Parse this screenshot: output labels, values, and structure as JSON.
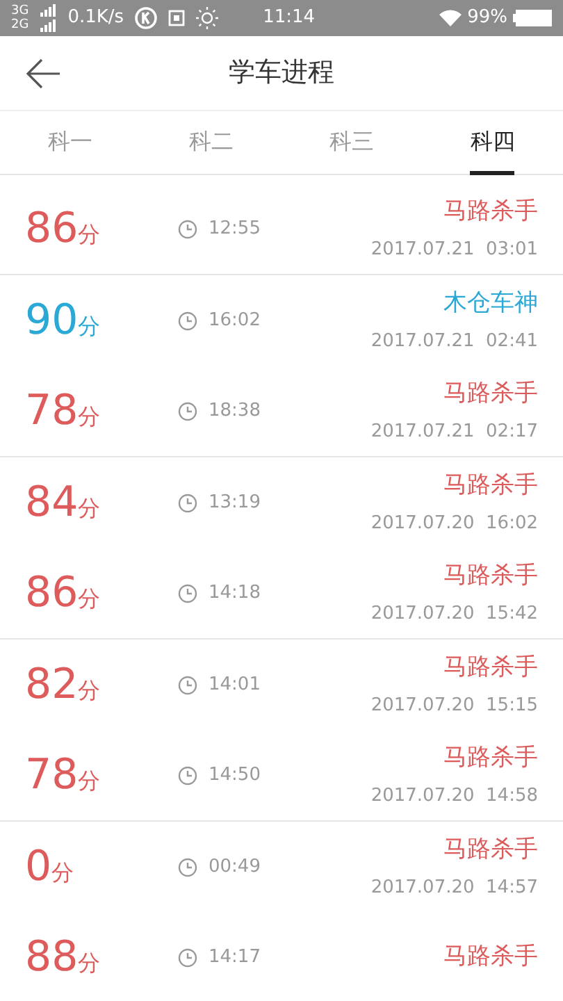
{
  "status_bar": {
    "signal_top": "3G",
    "signal_bottom": "2G",
    "speed": "0.1K/s",
    "time": "11:14",
    "battery": "99%"
  },
  "header": {
    "title": "学车进程"
  },
  "tabs": [
    {
      "label": "科一",
      "selected": false
    },
    {
      "label": "科二",
      "selected": false
    },
    {
      "label": "科三",
      "selected": false
    },
    {
      "label": "科四",
      "selected": true
    }
  ],
  "groups": [
    {
      "rows": [
        {
          "score": "86",
          "unit": "分",
          "duration": "12:55",
          "title": "马路杀手",
          "date": "2017.07.21  03:01",
          "color": "#dd5b5b"
        }
      ]
    },
    {
      "rows": [
        {
          "score": "90",
          "unit": "分",
          "duration": "16:02",
          "title": "木仓车神",
          "date": "2017.07.21  02:41",
          "color": "#2aa8d6"
        },
        {
          "score": "78",
          "unit": "分",
          "duration": "18:38",
          "title": "马路杀手",
          "date": "2017.07.21  02:17",
          "color": "#dd5b5b"
        }
      ]
    },
    {
      "rows": [
        {
          "score": "84",
          "unit": "分",
          "duration": "13:19",
          "title": "马路杀手",
          "date": "2017.07.20  16:02",
          "color": "#dd5b5b"
        },
        {
          "score": "86",
          "unit": "分",
          "duration": "14:18",
          "title": "马路杀手",
          "date": "2017.07.20  15:42",
          "color": "#dd5b5b"
        }
      ]
    },
    {
      "rows": [
        {
          "score": "82",
          "unit": "分",
          "duration": "14:01",
          "title": "马路杀手",
          "date": "2017.07.20  15:15",
          "color": "#dd5b5b"
        },
        {
          "score": "78",
          "unit": "分",
          "duration": "14:50",
          "title": "马路杀手",
          "date": "2017.07.20  14:58",
          "color": "#dd5b5b"
        }
      ]
    },
    {
      "rows": [
        {
          "score": "0",
          "unit": "分",
          "duration": "00:49",
          "title": "马路杀手",
          "date": "2017.07.20  14:57",
          "color": "#dd5b5b"
        },
        {
          "score": "88",
          "unit": "分",
          "duration": "14:17",
          "title": "马路杀手",
          "color": "#dd5b5b"
        }
      ]
    }
  ]
}
